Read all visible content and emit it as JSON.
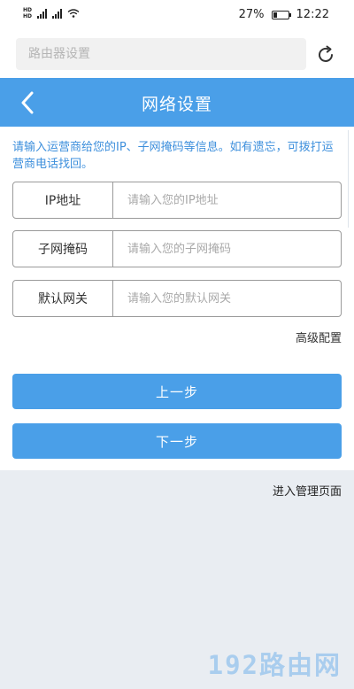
{
  "status_bar": {
    "left_glyphs": [
      "HD",
      "4G",
      "4G"
    ],
    "battery_percent": "27%",
    "time": "12:22"
  },
  "search": {
    "placeholder": "路由器设置"
  },
  "header": {
    "title": "网络设置",
    "back_icon": "chevron-left-icon",
    "color": "#4a9fe8"
  },
  "notice": "请输入运营商给您的IP、子网掩码等信息。如有遗忘，可拨打运营商电话找回。",
  "form": {
    "fields": [
      {
        "label": "IP地址",
        "placeholder": "请输入您的IP地址",
        "value": ""
      },
      {
        "label": "子网掩码",
        "placeholder": "请输入您的子网掩码",
        "value": ""
      },
      {
        "label": "默认网关",
        "placeholder": "请输入您的默认网关",
        "value": ""
      }
    ],
    "advanced_link": "高级配置"
  },
  "buttons": {
    "prev": "上一步",
    "next": "下一步"
  },
  "footer_link": "进入管理页面",
  "watermark": "192路由网"
}
